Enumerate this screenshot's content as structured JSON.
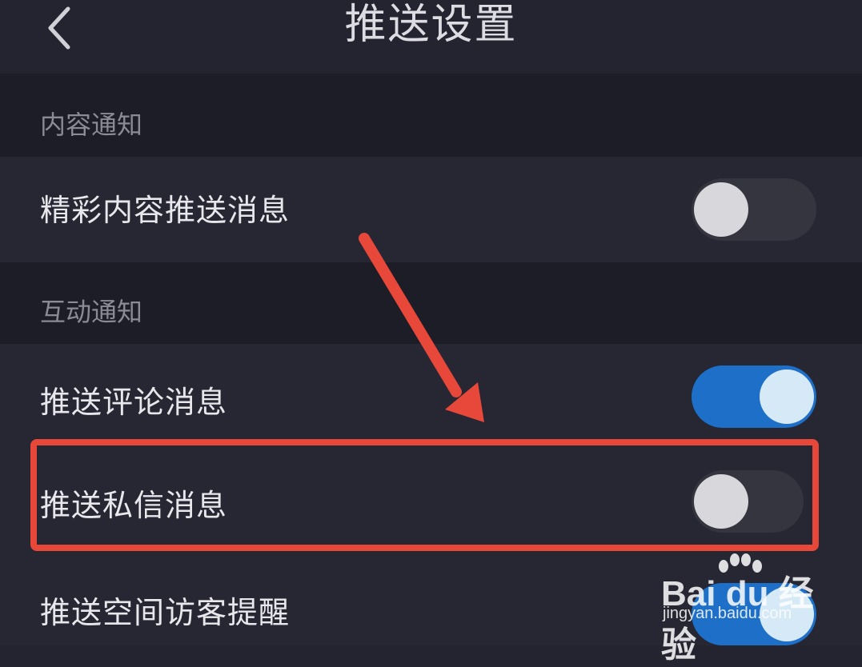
{
  "header": {
    "title": "推送设置",
    "back_icon": "chevron-left-icon"
  },
  "sections": [
    {
      "title": "内容通知",
      "items": [
        {
          "label": "精彩内容推送消息",
          "enabled": false
        }
      ]
    },
    {
      "title": "互动通知",
      "items": [
        {
          "label": "推送评论消息",
          "enabled": true
        },
        {
          "label": "推送私信消息",
          "enabled": false
        },
        {
          "label": "推送空间访客提醒",
          "enabled": true
        }
      ]
    }
  ],
  "colors": {
    "background": "#232430",
    "section_background": "#1c1d26",
    "toggle_on": "#1d6fc8",
    "toggle_off": "#34353f",
    "annotation": "#e8483a"
  },
  "watermark": {
    "logo_text": "Bai du 经验",
    "url": "jingyan.baidu.com"
  }
}
